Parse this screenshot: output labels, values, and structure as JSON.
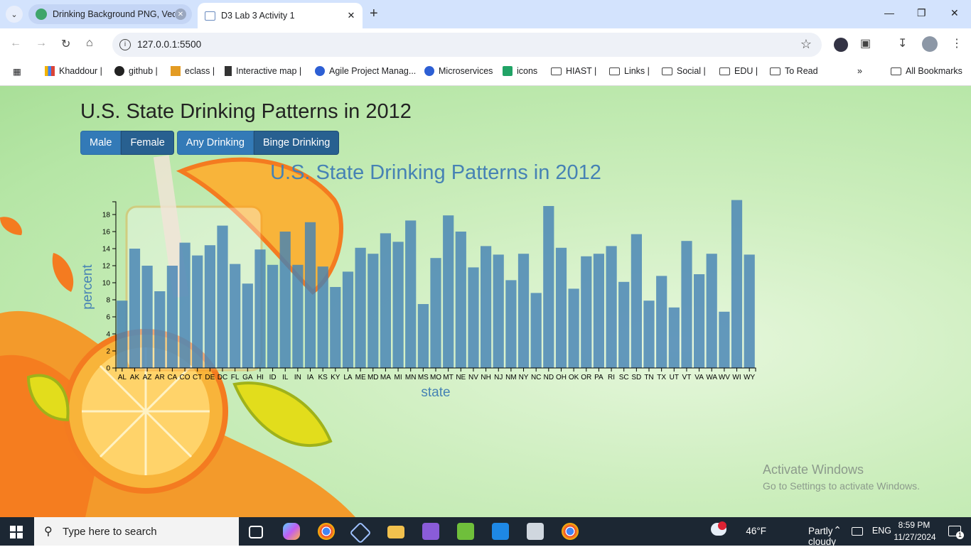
{
  "browser": {
    "tabs": [
      {
        "title": "Drinking Background PNG, Vect",
        "active": false
      },
      {
        "title": "D3 Lab 3 Activity 1",
        "active": true
      }
    ],
    "url": "127.0.0.1:5500"
  },
  "bookmarks": {
    "items": [
      {
        "label": "Khaddour |"
      },
      {
        "label": "github |"
      },
      {
        "label": "eclass |"
      },
      {
        "label": "Interactive map |"
      },
      {
        "label": "Agile Project Manag..."
      },
      {
        "label": "Microservices"
      },
      {
        "label": "icons"
      },
      {
        "label": "HIAST |"
      },
      {
        "label": "Links |"
      },
      {
        "label": "Social |"
      },
      {
        "label": "EDU |"
      },
      {
        "label": "To Read"
      }
    ],
    "all_label": "All Bookmarks"
  },
  "page": {
    "title": "U.S. State Drinking Patterns in 2012",
    "buttons": {
      "male": "Male",
      "female": "Female",
      "any": "Any Drinking",
      "binge": "Binge Drinking"
    }
  },
  "chart_data": {
    "type": "bar",
    "title": "U.S. State Drinking Patterns in 2012",
    "xlabel": "state",
    "ylabel": "percent",
    "ylim": [
      0,
      19.5
    ],
    "yticks": [
      0,
      2,
      4,
      6,
      8,
      10,
      12,
      14,
      16,
      18
    ],
    "bar_color": "#4682b4",
    "categories": [
      "AL",
      "AK",
      "AZ",
      "AR",
      "CA",
      "CO",
      "CT",
      "DE",
      "DC",
      "FL",
      "GA",
      "HI",
      "ID",
      "IL",
      "IN",
      "IA",
      "KS",
      "KY",
      "LA",
      "ME",
      "MD",
      "MA",
      "MI",
      "MN",
      "MS",
      "MO",
      "MT",
      "NE",
      "NV",
      "NH",
      "NJ",
      "NM",
      "NY",
      "NC",
      "ND",
      "OH",
      "OK",
      "OR",
      "PA",
      "RI",
      "SC",
      "SD",
      "TN",
      "TX",
      "UT",
      "VT",
      "VA",
      "WA",
      "WV",
      "WI",
      "WY"
    ],
    "values": [
      7.9,
      14.0,
      12.0,
      9.0,
      12.0,
      14.7,
      13.2,
      14.4,
      16.7,
      12.2,
      9.9,
      13.9,
      12.1,
      16.0,
      12.1,
      17.1,
      11.9,
      9.5,
      11.3,
      14.1,
      13.4,
      15.8,
      14.8,
      17.3,
      7.5,
      12.9,
      17.9,
      16.0,
      11.8,
      14.3,
      13.3,
      10.3,
      13.4,
      8.8,
      19.0,
      14.1,
      9.3,
      13.1,
      13.4,
      14.3,
      10.1,
      15.7,
      7.9,
      10.8,
      7.1,
      14.9,
      11.0,
      13.4,
      6.6,
      19.7,
      13.3
    ]
  },
  "watermark": {
    "line1": "Activate Windows",
    "line2": "Go to Settings to activate Windows."
  },
  "taskbar": {
    "search_placeholder": "Type here to search",
    "temperature": "46°F",
    "weather": "Partly cloudy",
    "lang": "ENG",
    "time": "8:59 PM",
    "date": "11/27/2024",
    "notif_count": "1"
  }
}
